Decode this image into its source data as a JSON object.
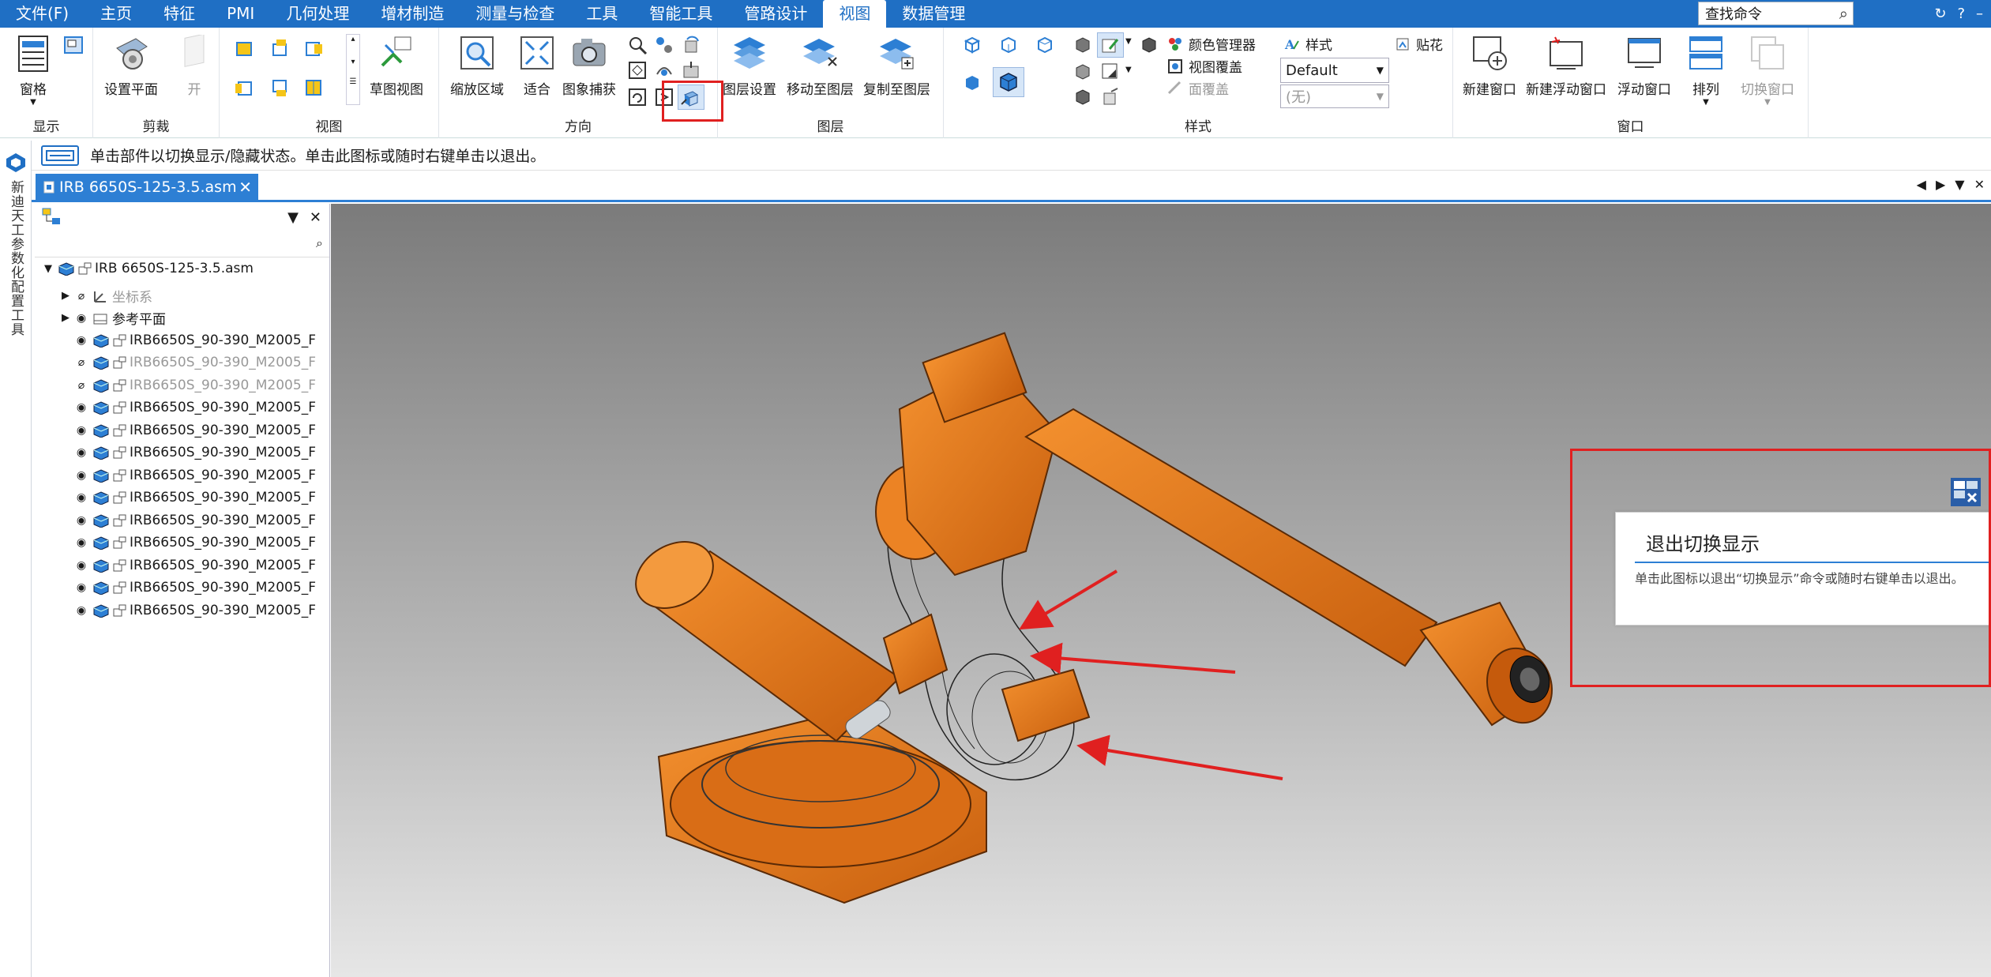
{
  "menubar": {
    "items": [
      "文件(F)",
      "主页",
      "特征",
      "PMI",
      "几何处理",
      "增材制造",
      "测量与检查",
      "工具",
      "智能工具",
      "管路设计",
      "视图",
      "数据管理"
    ],
    "active_index": 10,
    "search_placeholder": "查找命令",
    "window_controls": [
      "↻",
      "?",
      "–"
    ]
  },
  "ribbon": {
    "display": {
      "pane_label": "窗格",
      "group": "显示"
    },
    "clip": {
      "set_plane": "设置平面",
      "open": "开",
      "group": "剪裁"
    },
    "view": {
      "sketch_view": "草图视图",
      "group": "视图"
    },
    "orientation": {
      "zoom_area": "缩放区域",
      "fit": "适合",
      "image_capture": "图象捕获",
      "group": "方向"
    },
    "layers": {
      "layer_settings": "图层设置",
      "move_to_layer": "移动至图层",
      "copy_to_layer": "复制至图层",
      "group": "图层"
    },
    "style": {
      "color_manager": "颜色管理器",
      "view_overlay": "视图覆盖",
      "face_overlay": "面覆盖",
      "style_label": "样式",
      "decal": "贴花",
      "style_value": "Default",
      "overlay_value": "(无)",
      "group": "样式"
    },
    "window": {
      "new_window": "新建窗口",
      "new_floating": "新建浮动窗口",
      "floating": "浮动窗口",
      "arrange": "排列",
      "switch_window": "切换窗口",
      "group": "窗口"
    }
  },
  "hint": {
    "text": "单击部件以切换显示/隐藏状态。单击此图标或随时右键单击以退出。"
  },
  "side_panel": {
    "vertical_text": "新迪天工参数化配置工具"
  },
  "document_tab": {
    "label": "IRB 6650S-125-3.5.asm"
  },
  "tree": {
    "root": "IRB 6650S-125-3.5.asm",
    "folders": [
      "坐标系",
      "参考平面"
    ],
    "parts": [
      {
        "label": "IRB6650S_90-390_M2005_F",
        "hidden": false
      },
      {
        "label": "IRB6650S_90-390_M2005_F",
        "hidden": true
      },
      {
        "label": "IRB6650S_90-390_M2005_F",
        "hidden": true
      },
      {
        "label": "IRB6650S_90-390_M2005_F",
        "hidden": false
      },
      {
        "label": "IRB6650S_90-390_M2005_F",
        "hidden": false
      },
      {
        "label": "IRB6650S_90-390_M2005_F",
        "hidden": false
      },
      {
        "label": "IRB6650S_90-390_M2005_F",
        "hidden": false
      },
      {
        "label": "IRB6650S_90-390_M2005_F",
        "hidden": false
      },
      {
        "label": "IRB6650S_90-390_M2005_F",
        "hidden": false
      },
      {
        "label": "IRB6650S_90-390_M2005_F",
        "hidden": false
      },
      {
        "label": "IRB6650S_90-390_M2005_F",
        "hidden": false
      },
      {
        "label": "IRB6650S_90-390_M2005_F",
        "hidden": false
      },
      {
        "label": "IRB6650S_90-390_M2005_F",
        "hidden": false
      }
    ]
  },
  "tooltip": {
    "title": "退出切换显示",
    "body": "单击此图标以退出“切换显示”命令或随时右键单击以退出。"
  },
  "colors": {
    "accent": "#1f6fc4",
    "model": "#e87a1c",
    "annotation": "#e02020"
  }
}
